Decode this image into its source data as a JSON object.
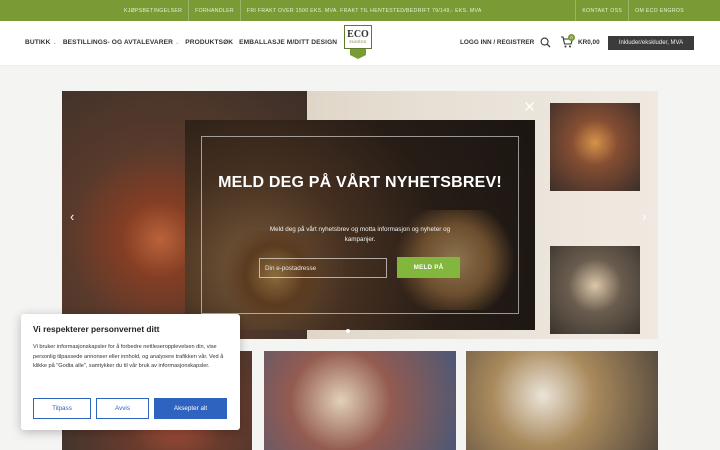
{
  "topbar": {
    "left_items": [
      "KJØPSBETINGELSER",
      "FORHANDLER",
      "FRI FRAKT OVER 1500 EKS. MVA. FRAKT TIL HENTESTED/BEDRIFT 79/149,- EKS. MVA"
    ],
    "right_items": [
      "KONTAKT OSS",
      "OM ECO ENGROS"
    ],
    "color": "#7a9a35"
  },
  "header": {
    "nav": [
      "BUTIKK",
      "BESTILLINGS- OG AVTALEVARER",
      "PRODUKTSØK",
      "EMBALLASJE M/DITT DESIGN"
    ],
    "logo": {
      "line1": "ECO",
      "line2": "ENGROS"
    },
    "login": "LOGG INN / REGISTRER",
    "cart_count": "0",
    "cart_total": "KR0,00",
    "vat_toggle": "Inkluder/ekskluder, MVA"
  },
  "popup": {
    "title": "MELD DEG PÅ VÅRT NYHETSBREV!",
    "subtitle": "Meld deg på vårt nyhetsbrev og motta informasjon og nyheter og kampanjer.",
    "email_placeholder": "Din e-postadresse",
    "submit_label": "MELD PÅ",
    "accent": "#82b63c"
  },
  "cookie": {
    "title": "Vi respekterer personvernet ditt",
    "body": "Vi bruker informasjonskapsler for å forbedre nettleseropplevelsen din, vise personlig tilpassede annonser eller innhold, og analysere trafikken vår. Ved å klikke på \"Godta alle\", samtykker du til vår bruk av informasjonskapsler.",
    "customize_label": "Tilpass",
    "reject_label": "Avvis",
    "accept_label": "Aksepter alt",
    "accent": "#2f63c0"
  }
}
